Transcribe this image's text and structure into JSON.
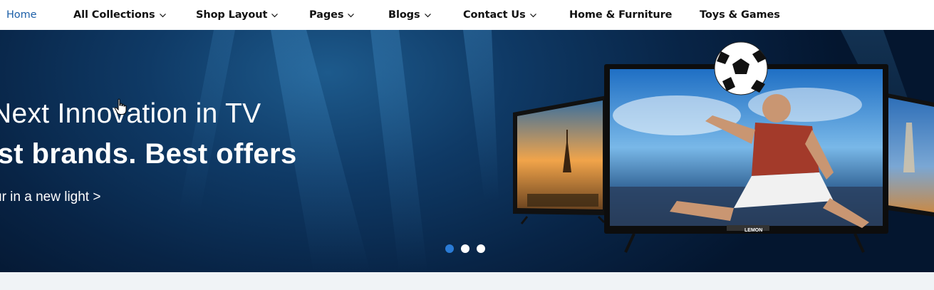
{
  "nav": {
    "items": [
      {
        "label": "Home",
        "active": true,
        "dropdown": false
      },
      {
        "label": "All Collections",
        "active": false,
        "dropdown": true
      },
      {
        "label": "Shop Layout",
        "active": false,
        "dropdown": true
      },
      {
        "label": "Pages",
        "active": false,
        "dropdown": true
      },
      {
        "label": "Blogs",
        "active": false,
        "dropdown": true
      },
      {
        "label": "Contact Us",
        "active": false,
        "dropdown": true
      },
      {
        "label": "Home & Furniture",
        "active": false,
        "dropdown": false
      },
      {
        "label": "Toys & Games",
        "active": false,
        "dropdown": false
      }
    ],
    "active_color": "#1d5fa8",
    "text_color": "#111111"
  },
  "hero": {
    "heading_line1": "Next Innovation in TV",
    "heading_line2": "est brands. Best offers",
    "cta_link": "ur in a new light >",
    "tv_brand_label": "LEMON",
    "slides_total": 3,
    "active_slide": 1,
    "dot_active_color": "#2a7bd6"
  },
  "icons": {
    "nav_dropdown": "chevron-down-icon",
    "cursor": "hand-pointer-icon"
  }
}
